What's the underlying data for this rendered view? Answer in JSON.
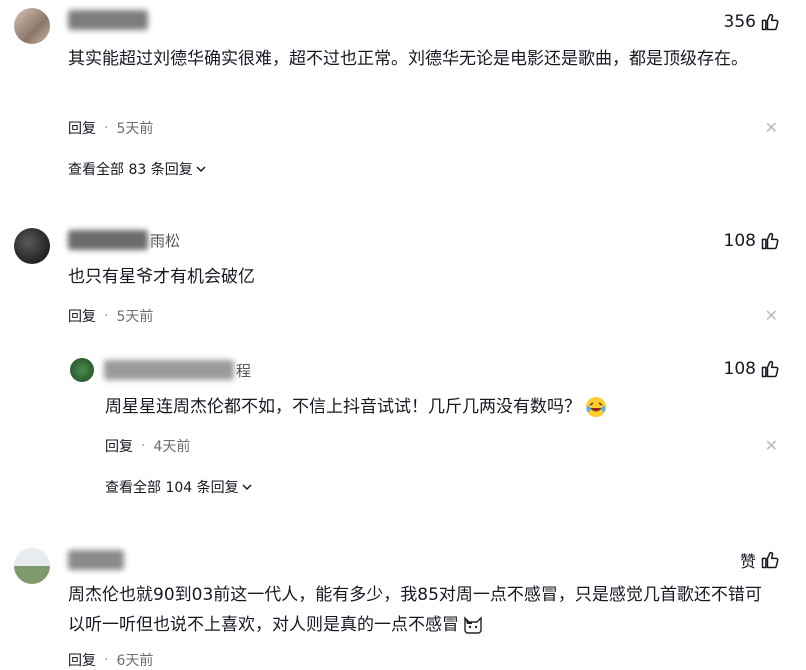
{
  "comments": [
    {
      "like_count": "356",
      "text": "其实能超过刘德华确实很难，超不过也正常。刘德华无论是电影还是歌曲，都是顶级存在。",
      "reply_label": "回复",
      "time": "5天前",
      "expand_label": "查看全部 83 条回复"
    },
    {
      "name_fragment": "雨松",
      "like_count": "108",
      "text": "也只有星爷才有机会破亿",
      "reply_label": "回复",
      "time": "5天前",
      "reply": {
        "name_fragment": "程",
        "like_count": "108",
        "text": "周星星连周杰伦都不如，不信上抖音试试！几斤几两没有数吗？",
        "reply_label": "回复",
        "time": "4天前",
        "expand_label": "查看全部 104 条回复"
      }
    },
    {
      "like_label": "赞",
      "text": "周杰伦也就90到03前这一代人，能有多少，我85对周一点不感冒，只是感觉几首歌还不错可以听一听但也说不上喜欢，对人则是真的一点不感冒",
      "reply_label": "回复",
      "time": "6天前"
    }
  ],
  "icons": [
    "thumb-up-icon",
    "close-icon",
    "chevron-down-icon",
    "laugh-cry-emoji-icon",
    "cat-emoji-icon"
  ],
  "colors": {
    "text": "#161823",
    "meta": "#6b6e76",
    "muted": "#b8bac0"
  }
}
